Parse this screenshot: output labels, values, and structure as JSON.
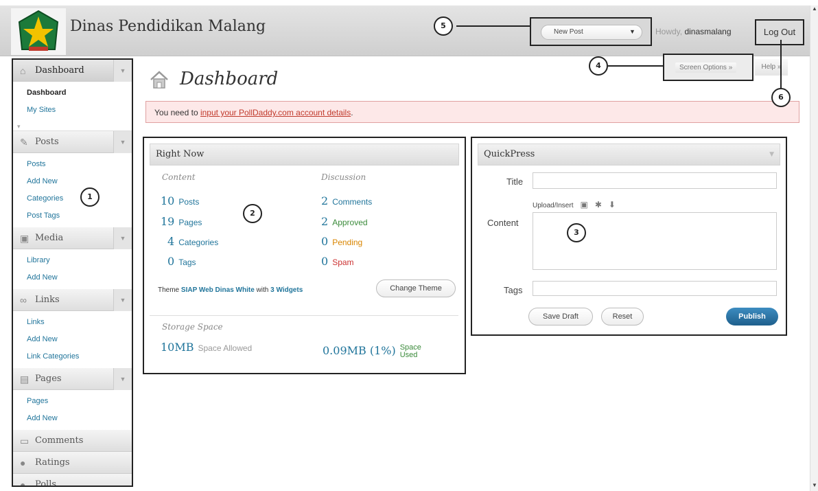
{
  "header": {
    "site_title": "Dinas Pendidikan Malang",
    "favorite_action": "New Post",
    "howdy_prefix": "Howdy, ",
    "username": "dinasmalang",
    "logout_label": "Log Out"
  },
  "sidebar": {
    "dashboard": {
      "label": "Dashboard",
      "items": [
        "Dashboard",
        "My Sites"
      ]
    },
    "posts": {
      "label": "Posts",
      "items": [
        "Posts",
        "Add New",
        "Categories",
        "Post Tags"
      ]
    },
    "media": {
      "label": "Media",
      "items": [
        "Library",
        "Add New"
      ]
    },
    "links": {
      "label": "Links",
      "items": [
        "Links",
        "Add New",
        "Link Categories"
      ]
    },
    "pages": {
      "label": "Pages",
      "items": [
        "Pages",
        "Add New"
      ]
    },
    "comments": {
      "label": "Comments"
    },
    "ratings": {
      "label": "Ratings"
    },
    "polls": {
      "label": "Polls"
    }
  },
  "main": {
    "title": "Dashboard",
    "screen_options": "Screen Options »",
    "help": "Help »",
    "notice_prefix": "You need to ",
    "notice_link": "input your PollDaddy.com account details",
    "notice_suffix": "."
  },
  "right_now": {
    "title": "Right Now",
    "content_heading": "Content",
    "discussion_heading": "Discussion",
    "content": [
      {
        "count": "10",
        "label": "Posts"
      },
      {
        "count": "19",
        "label": "Pages"
      },
      {
        "count": "4",
        "label": "Categories"
      },
      {
        "count": "0",
        "label": "Tags"
      }
    ],
    "discussion": [
      {
        "count": "2",
        "label": "Comments"
      },
      {
        "count": "2",
        "label": "Approved"
      },
      {
        "count": "0",
        "label": "Pending"
      },
      {
        "count": "0",
        "label": "Spam"
      }
    ],
    "theme_prefix": "Theme ",
    "theme_name": "SIAP Web Dinas White",
    "theme_mid": " with ",
    "widgets": "3 Widgets",
    "change_theme": "Change Theme",
    "storage_heading": "Storage Space",
    "space_allowed_value": "10MB",
    "space_allowed_label": "Space Allowed",
    "space_used_value": "0.09MB (1%)",
    "space_used_label": "Space Used"
  },
  "quickpress": {
    "title": "QuickPress",
    "title_label": "Title",
    "upload_label": "Upload/Insert",
    "content_label": "Content",
    "tags_label": "Tags",
    "save_draft": "Save Draft",
    "reset": "Reset",
    "publish": "Publish"
  },
  "callouts": [
    "1",
    "2",
    "3",
    "4",
    "5",
    "6"
  ],
  "colors": {
    "link": "#21759b",
    "notice_bg": "#fde8e8",
    "publish": "#1e5f8c"
  }
}
